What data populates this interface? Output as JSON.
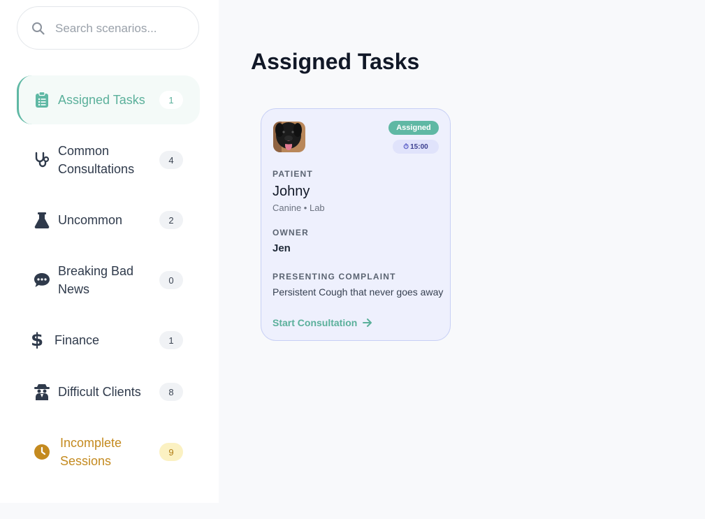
{
  "search": {
    "placeholder": "Search scenarios..."
  },
  "sidebar": {
    "items": [
      {
        "label": "Assigned Tasks",
        "count": "1"
      },
      {
        "label": "Common\nConsultations",
        "count": "4"
      },
      {
        "label": "Uncommon",
        "count": "2"
      },
      {
        "label": "Breaking Bad\nNews",
        "count": "0"
      },
      {
        "label": "Finance",
        "count": "1"
      },
      {
        "label": "Difficult Clients",
        "count": "8"
      },
      {
        "label": "Incomplete\nSessions",
        "count": "9"
      }
    ]
  },
  "main": {
    "title": "Assigned Tasks",
    "card": {
      "status": "Assigned",
      "time": "15:00",
      "patient_label": "PATIENT",
      "patient_name": "Johny",
      "patient_meta": "Canine • Lab",
      "owner_label": "OWNER",
      "owner_name": "Jen",
      "complaint_label": "PRESENTING COMPLAINT",
      "complaint": "Persistent Cough that never goes away",
      "action": "Start Consultation"
    }
  },
  "colors": {
    "accent": "#5fb8a4",
    "warning": "#c48a1f",
    "card_bg": "#eef0fd",
    "text_dark": "#111827"
  }
}
